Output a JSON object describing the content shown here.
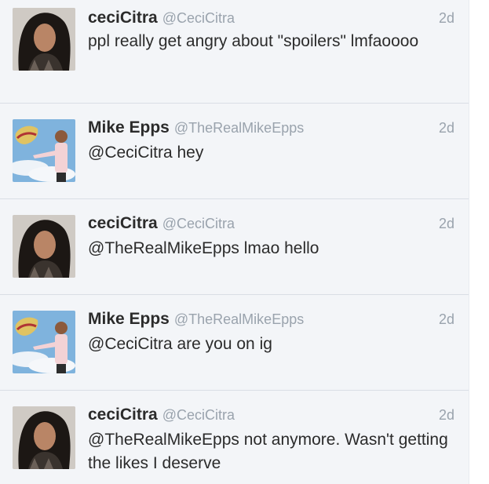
{
  "tweets": [
    {
      "name": "ceciCitra",
      "handle": "@CeciCitra",
      "time": "2d",
      "text": "ppl really get angry about \"spoilers\" lmfaoooo",
      "avatar": "ceci-avatar"
    },
    {
      "name": "Mike Epps",
      "handle": "@TheRealMikeEpps",
      "time": "2d",
      "text": "@CeciCitra hey",
      "avatar": "mike-avatar"
    },
    {
      "name": "ceciCitra",
      "handle": "@CeciCitra",
      "time": "2d",
      "text": "@TheRealMikeEpps lmao hello",
      "avatar": "ceci-avatar"
    },
    {
      "name": "Mike Epps",
      "handle": "@TheRealMikeEpps",
      "time": "2d",
      "text": "@CeciCitra are you on ig",
      "avatar": "mike-avatar"
    },
    {
      "name": "ceciCitra",
      "handle": "@CeciCitra",
      "time": "2d",
      "text": "@TheRealMikeEpps not anymore. Wasn't getting the likes I deserve",
      "avatar": "ceci-avatar"
    }
  ],
  "colors": {
    "background": "#f3f5f8",
    "name": "#2b2b2b",
    "meta": "#9aa3ad",
    "divider": "#d9dee5"
  }
}
